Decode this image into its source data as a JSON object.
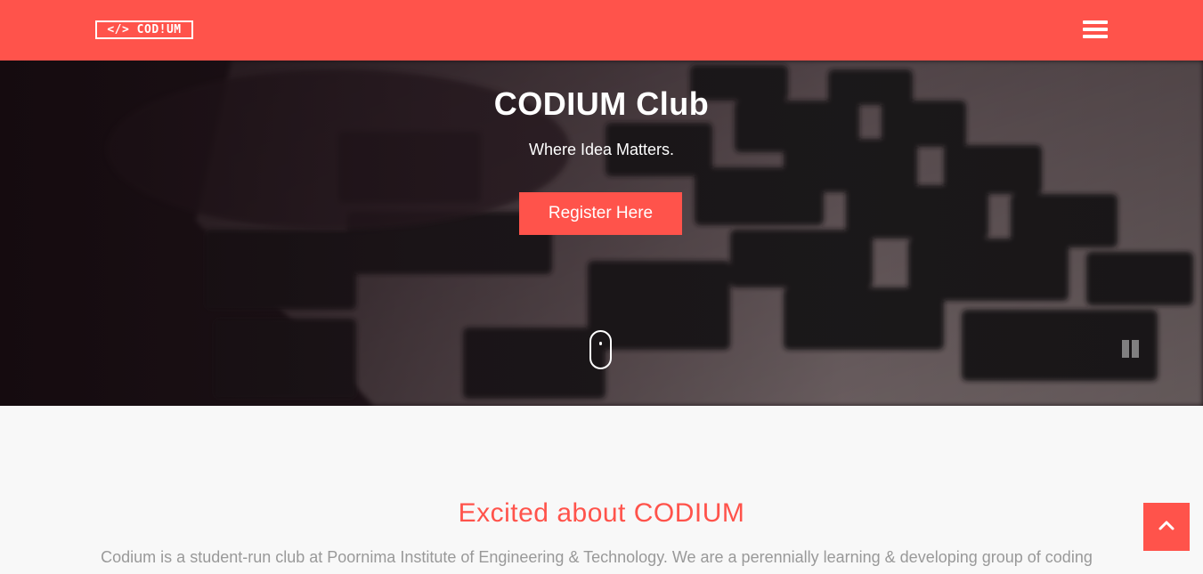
{
  "brand": {
    "logo_text": "</> COD!UM",
    "accent_color": "#ff534b"
  },
  "navbar": {
    "menu_icon": "hamburger-menu-icon"
  },
  "hero": {
    "title": "CODIUM Club",
    "subtitle": "Where Idea Matters.",
    "register_label": "Register Here",
    "scroll_icon": "scroll-down-mouse-icon",
    "pause_icon": "pause-icon"
  },
  "about": {
    "title": "Excited about CODIUM",
    "text": "Codium is a student-run club at Poornima Institute of Engineering & Technology. We are a perennially learning & developing group of coding"
  },
  "back_to_top": {
    "icon": "chevron-up-icon"
  }
}
